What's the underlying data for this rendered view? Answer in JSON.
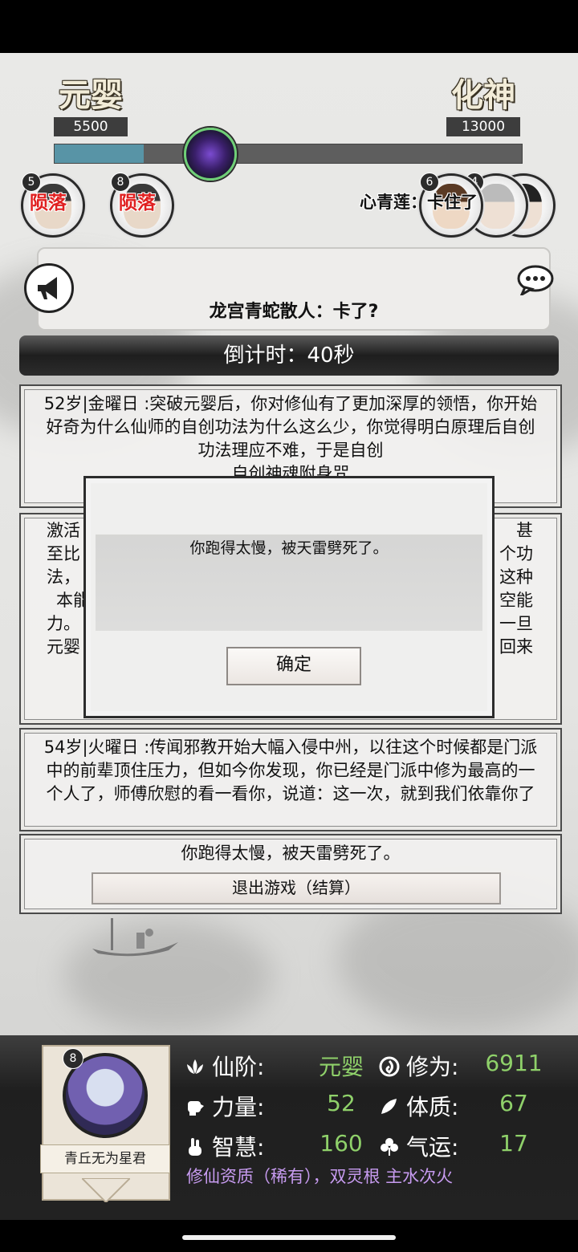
{
  "header": {
    "current_realm": "元婴",
    "current_realm_value": "5500",
    "next_realm": "化神",
    "next_realm_value": "13000",
    "progress_fraction": 0.19
  },
  "players": {
    "fallen": [
      {
        "level": "5",
        "status": "陨落"
      },
      {
        "level": "8",
        "status": "陨落"
      }
    ],
    "right_levels": [
      "6",
      "4"
    ],
    "chat_line": "心青莲：卡住了"
  },
  "message": {
    "text": "龙宫青蛇散人：卡了?"
  },
  "countdown": "倒计时：40秒",
  "events": {
    "e1_text": "52岁|金曜日 :突破元婴后，你对修仙有了更加深厚的领悟，你开始好奇为什么仙师的自创功法为什么这么少，你觉得明白原理后自创功法理应不难，于是自创",
    "e1_highlight": "自创神魂附身咒",
    "e2_lines": [
      "激活",
      "至比",
      "法，",
      "本能",
      "力。",
      "元婴"
    ],
    "e2_right": [
      "甚",
      "个功",
      "这种",
      "空能",
      "一旦",
      "回来"
    ],
    "e3_text": "54岁|火曜日 :传闻邪教开始大幅入侵中州，以往这个时候都是门派中的前辈顶住压力，但如今你发现，你已经是门派中修为最高的一个人了，师傅欣慰的看一看你，说道：这一次，就到我们依靠你了",
    "e4_text": "你跑得太慢，被天雷劈死了。",
    "exit_button": "退出游戏（结算）"
  },
  "dialog": {
    "message": "你跑得太慢，被天雷劈死了。",
    "ok_button": "确定"
  },
  "character": {
    "level": "8",
    "name": "青丘无为星君",
    "stats": {
      "realm_label": "仙阶:",
      "realm_value": "元婴",
      "cultivation_label": "修为:",
      "cultivation_value": "6911",
      "strength_label": "力量:",
      "strength_value": "52",
      "constitution_label": "体质:",
      "constitution_value": "67",
      "wisdom_label": "智慧:",
      "wisdom_value": "160",
      "luck_label": "气运:",
      "luck_value": "17"
    },
    "aptitude": "修仙资质（稀有），双灵根 主水次火"
  },
  "colors": {
    "progress_fill": "#5894a6",
    "stat_value": "#8fd16a",
    "highlight": "#f0931e",
    "fallen": "#e02020",
    "aptitude": "#c79bf0"
  }
}
